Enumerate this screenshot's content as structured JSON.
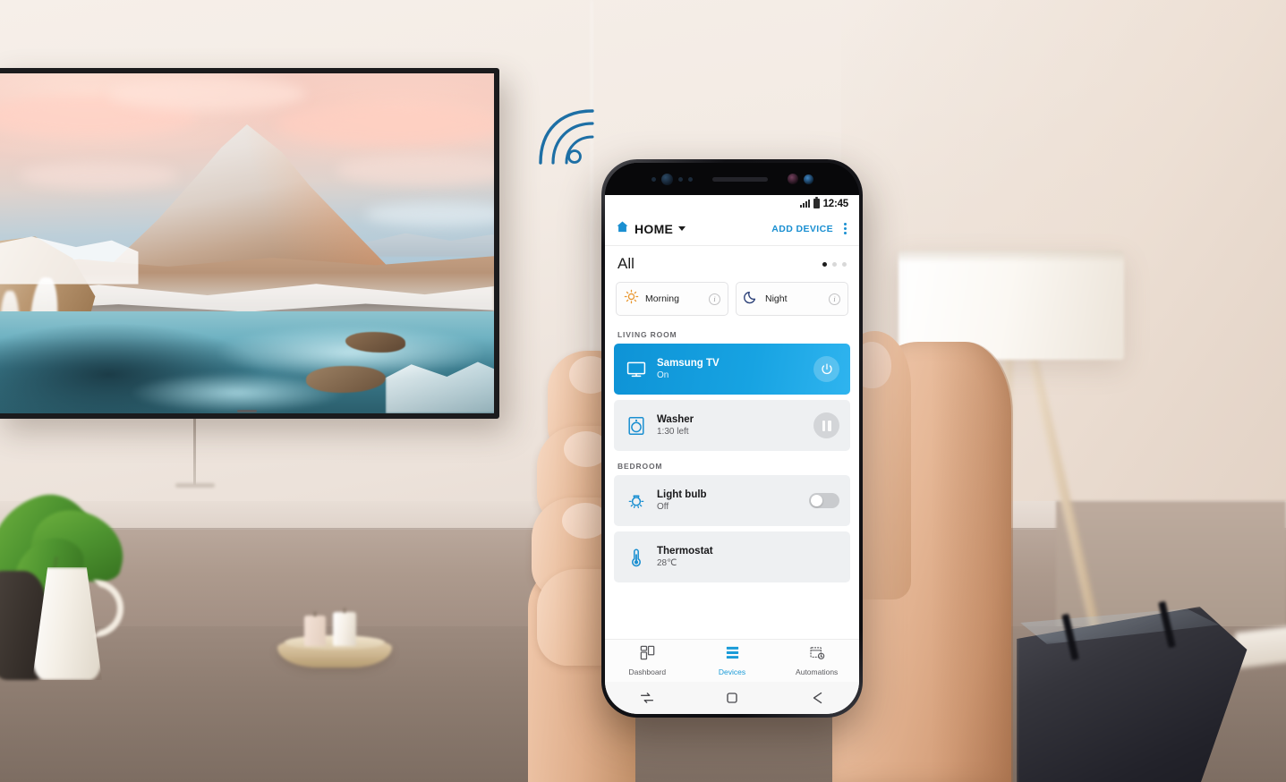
{
  "scene": {
    "description": "Living room with wall-mounted Samsung TV showing a mountain landscape, a hand holding a Galaxy phone running the SmartThings app",
    "wifi_icon": "wifi-signal-icon",
    "tv": {
      "name": "Samsung TV",
      "content_title": "Kirkjufell mountain at sunset",
      "brand_logo": "samsung-logo"
    },
    "furniture": [
      {
        "name": "tripod-floor-lamp"
      },
      {
        "name": "monstera-plant-pitcher"
      },
      {
        "name": "candle-tray"
      },
      {
        "name": "leather-sofa"
      },
      {
        "name": "console-sideboard"
      }
    ]
  },
  "phone": {
    "status_bar": {
      "signal_icon": "signal-bars-icon",
      "battery_icon": "battery-icon",
      "time": "12:45"
    },
    "app_bar": {
      "home_icon": "house-icon",
      "title": "HOME",
      "dropdown_icon": "chevron-down-icon",
      "add_device_label": "ADD DEVICE",
      "overflow_icon": "kebab-menu-icon"
    },
    "all_row": {
      "label": "All",
      "page_dots": {
        "total": 3,
        "active_index": 0
      }
    },
    "scenes": [
      {
        "name": "Morning",
        "icon": "sun-icon",
        "icon_color": "#e8962e",
        "info_label": "i"
      },
      {
        "name": "Night",
        "icon": "moon-icon",
        "icon_color": "#2a3f77",
        "info_label": "i"
      }
    ],
    "rooms": [
      {
        "label": "LIVING ROOM",
        "devices": [
          {
            "name": "Samsung TV",
            "status": "On",
            "icon": "tv-icon",
            "active": true,
            "action": "power-button",
            "accent": "#12a0dd"
          },
          {
            "name": "Washer",
            "status": "1:30 left",
            "icon": "washer-icon",
            "active": false,
            "action": "pause-button"
          }
        ]
      },
      {
        "label": "BEDROOM",
        "devices": [
          {
            "name": "Light bulb",
            "status": "Off",
            "icon": "lightbulb-icon",
            "active": false,
            "action": "toggle-off"
          },
          {
            "name": "Thermostat",
            "status": "28℃",
            "icon": "thermometer-icon",
            "active": false,
            "action": "none"
          }
        ]
      }
    ],
    "bottom_nav": [
      {
        "label": "Dashboard",
        "icon": "dashboard-grid-icon",
        "active": false
      },
      {
        "label": "Devices",
        "icon": "devices-list-icon",
        "active": true
      },
      {
        "label": "Automations",
        "icon": "automations-calendar-icon",
        "active": false
      }
    ],
    "system_nav": [
      {
        "name": "recents-button",
        "icon": "recents-icon"
      },
      {
        "name": "home-button",
        "icon": "home-square-icon"
      },
      {
        "name": "back-button",
        "icon": "back-arrow-icon"
      }
    ]
  },
  "colors": {
    "accent_blue": "#1a9bd8",
    "active_card_blue": "#12a0dd",
    "link_blue": "#1a8fd1",
    "card_gray": "#eef0f2",
    "text_dark": "#18181a",
    "text_sub": "#5d5d61",
    "morning_orange": "#e8962e",
    "night_navy": "#2a3f77"
  }
}
